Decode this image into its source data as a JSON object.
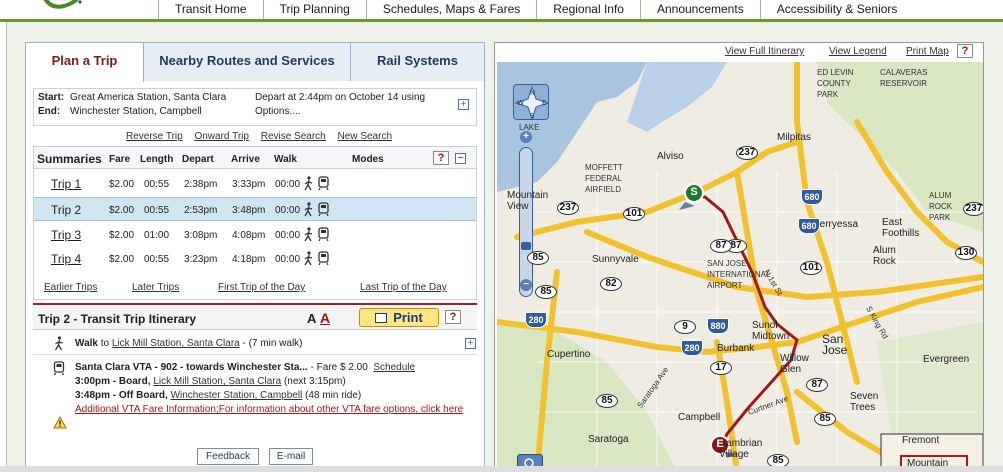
{
  "nav": {
    "tabs": [
      {
        "label": "Transit Home"
      },
      {
        "label": "Trip Planning"
      },
      {
        "label": "Schedules, Maps & Fares"
      },
      {
        "label": "Regional Info"
      },
      {
        "label": "Announcements"
      },
      {
        "label": "Accessibility & Seniors"
      }
    ]
  },
  "panel": {
    "tabs": [
      {
        "label": "Plan a Trip"
      },
      {
        "label": "Nearby Routes and Services"
      },
      {
        "label": "Rail Systems"
      }
    ]
  },
  "trip": {
    "start_label": "Start:",
    "start": "Great America Station, Santa Clara",
    "end_label": "End:",
    "end": "Winchester Station, Campbell",
    "depart_line1": "Depart at 2:44pm on October 14 using",
    "depart_line2": "Options....",
    "expand": "+"
  },
  "actions": {
    "reverse": "Reverse Trip",
    "onward": "Onward Trip",
    "revise": "Revise Search",
    "new": "New Search"
  },
  "summaries": {
    "title": "Summaries",
    "headers": {
      "fare": "Fare",
      "length": "Length",
      "depart": "Depart",
      "arrive": "Arrive",
      "walk": "Walk",
      "modes": "Modes"
    },
    "help": "?",
    "collapse": "−",
    "rows": [
      {
        "name": "Trip 1",
        "fare": "$2.00",
        "length": "00:55",
        "depart": "2:38pm",
        "arrive": "3:33pm",
        "walk": "00:00"
      },
      {
        "name": "Trip 2",
        "fare": "$2.00",
        "length": "00:55",
        "depart": "2:53pm",
        "arrive": "3:48pm",
        "walk": "00:00"
      },
      {
        "name": "Trip 3",
        "fare": "$2.00",
        "length": "01:00",
        "depart": "3:08pm",
        "arrive": "4:08pm",
        "walk": "00:00"
      },
      {
        "name": "Trip 4",
        "fare": "$2.00",
        "length": "00:55",
        "depart": "3:23pm",
        "arrive": "4:18pm",
        "walk": "00:00"
      }
    ],
    "selected_index": 1,
    "links": {
      "earlier": "Earlier Trips",
      "later": "Later Trips",
      "first": "First Trip of the Day",
      "last": "Last Trip of the Day"
    }
  },
  "itinerary": {
    "title": "Trip 2 - Transit Trip Itinerary",
    "font_small": "A",
    "font_large": "A",
    "print": "Print",
    "help": "?",
    "walk_word": "Walk",
    "walk_to": " to ",
    "walk_place": "Lick Mill Station, Santa Clara",
    "walk_time": " - (7 min walk)",
    "route": "Santa Clara VTA - 902 - towards Winchester Sta...",
    "fare": " - Fare $ 2.00",
    "schedule": "Schedule",
    "board_time": "3:00pm - Board, ",
    "board_place": "Lick Mill Station, Santa Clara",
    "board_next": " (next 3:15pm)",
    "off_time": "3:48pm - Off Board, ",
    "off_place": "Winchester Station, Campbell",
    "off_ride": " (48 min ride)",
    "fare_note": "Additional VTA Fare Information;For information about other VTA fare options, click here",
    "feedback": "Feedback",
    "email": "E-mail"
  },
  "map": {
    "links": {
      "itinerary": "View Full Itinerary",
      "legend": "View Legend",
      "print": "Print Map",
      "help": "?"
    },
    "start_marker": "S",
    "end_marker": "E",
    "labels": {
      "alviso": "Alviso",
      "milpitas": "Milpitas",
      "moffett": "MOFFETT FEDERAL AIRFIELD",
      "mountain_view": "Mountain View",
      "sunnyvale": "Sunnyvale",
      "sjc": "SAN JOSE INTERNATIONAL AIRPORT",
      "berryessa": "Berryessa",
      "east_foothills": "East Foothills",
      "alum_rock": "Alum Rock",
      "cupertino": "Cupertino",
      "burbank": "Burbank",
      "sunol": "Sunol Midtown",
      "willow_glen": "Willow Glen",
      "san_jose": "San Jose",
      "evergreen": "Evergreen",
      "seven_trees": "Seven Trees",
      "campbell": "Campbell",
      "saratoga": "Saratoga",
      "cambrian": "Cambrian Village",
      "fremont": "Fremont",
      "mountain": "Mountain",
      "ed_levin": "ED LEVIN COUNTY PARK",
      "calaveras": "CALAVERAS RESERVOIR",
      "alum_rock_park": "ALUM ROCK PARK",
      "lake": "LAKE",
      "first_st": "N 1st St",
      "king_rd": "S King Rd",
      "curtner": "Curtner Ave",
      "saratoga_ave": "Saratoga Ave"
    },
    "shields": [
      "237",
      "237",
      "101",
      "87",
      "85",
      "85",
      "82",
      "87",
      "101",
      "9",
      "17",
      "87",
      "85",
      "130",
      "85",
      "237",
      "85"
    ],
    "interstates": [
      "680",
      "880",
      "280",
      "680",
      "280"
    ]
  },
  "colors": {
    "accent": "#6a9a2a",
    "route": "#a01818",
    "highway": "#f2c22e",
    "link_blue": "#1f3a5c"
  }
}
